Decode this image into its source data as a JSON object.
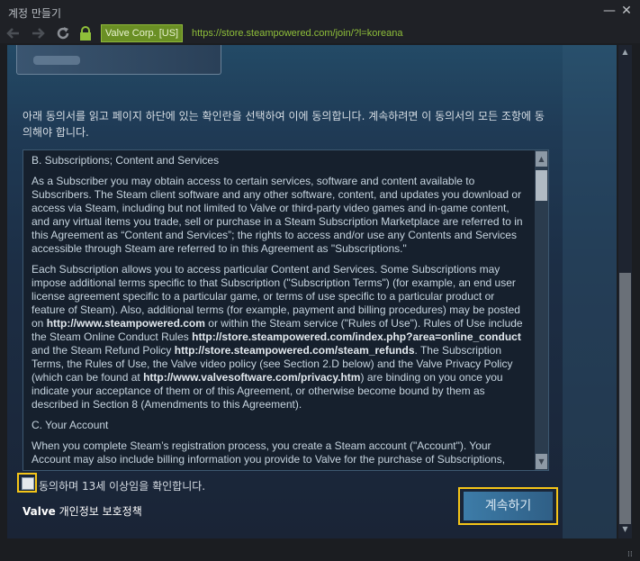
{
  "window": {
    "title": "계정 만들기",
    "minimize_glyph": "—",
    "close_glyph": "✕"
  },
  "navbar": {
    "back_icon": "back-arrow-icon",
    "forward_icon": "forward-arrow-icon",
    "reload_icon": "reload-icon",
    "lock_icon": "lock-icon",
    "certificate": "Valve Corp. [US]",
    "url": "https://store.steampowered.com/join/?l=koreana"
  },
  "page": {
    "intro": "아래 동의서를 읽고 페이지 하단에 있는 확인란을 선택하여 이에 동의합니다. 계속하려면 이 동의서의 모든 조항에 동의해야 합니다.",
    "agreement": {
      "h1": "B. Subscriptions; Content and Services",
      "p1": "As a Subscriber you may obtain access to certain services, software and content available to Subscribers. The Steam client software and any other software, content, and updates you download or access via Steam, including but not limited to Valve or third-party video games and in-game content, and any virtual items you trade, sell or purchase in a Steam Subscription Marketplace are referred to in this Agreement as “Content and Services”; the rights to access and/or use any Contents and Services accessible through Steam are referred to in this Agreement as \"Subscriptions.\"",
      "p2a": "Each Subscription allows you to access particular Content and Services. Some Subscriptions may impose additional terms specific to that Subscription (\"Subscription Terms\") (for example, an end user license agreement specific to a particular game, or terms of use specific to a particular product or feature of Steam). Also, additional terms (for example, payment and billing procedures) may be posted on ",
      "link1": "http://www.steampowered.com",
      "p2b": " or within the Steam service (\"Rules of Use\"). Rules of Use include the Steam Online Conduct Rules ",
      "link2": "http://store.steampowered.com/index.php?area=online_conduct",
      "p2c": " and the Steam Refund Policy ",
      "link3": "http://store.steampowered.com/steam_refunds",
      "p2d": ". The Subscription Terms, the Rules of Use, the Valve video policy (see Section 2.D below) and the Valve Privacy Policy (which can be found at ",
      "link4": "http://www.valvesoftware.com/privacy.htm",
      "p2e": ") are binding on you once you indicate your acceptance of them or of this Agreement, or otherwise become bound by them as described in Section 8 (Amendments to this Agreement).",
      "h2": "C. Your Account",
      "p3": "When you complete Steam’s registration process, you create a Steam account (\"Account\"). Your Account may also include billing information you provide to Valve for the purchase of Subscriptions,"
    },
    "checkbox_label": "동의하며 13세 이상임을 확인합니다.",
    "privacy_prefix": "Valve",
    "privacy_suffix": " 개인정보 보호정책",
    "continue_label": "계속하기"
  },
  "colors": {
    "accent_highlight": "#f5c518",
    "certificate_green": "#6a8f24",
    "url_green": "#8fbf3a",
    "button_blue": "#3d7ca8"
  }
}
